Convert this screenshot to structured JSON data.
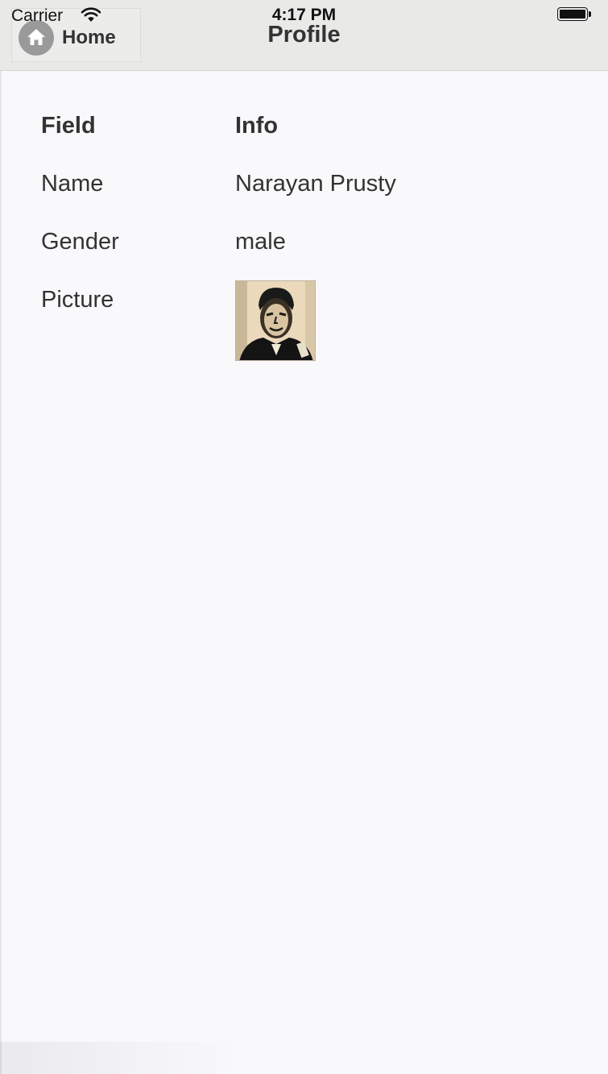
{
  "status_bar": {
    "carrier": "Carrier",
    "time": "4:17 PM",
    "wifi_icon": "wifi-icon",
    "battery_icon": "battery-icon"
  },
  "header": {
    "title": "Profile",
    "home_button_label": "Home",
    "home_icon": "home-icon",
    "background": "#e9e9e7"
  },
  "table": {
    "headers": [
      "Field",
      "Info"
    ],
    "rows": [
      {
        "field": "Name",
        "info": "Narayan Prusty"
      },
      {
        "field": "Gender",
        "info": "male"
      },
      {
        "field": "Picture",
        "info": ""
      }
    ]
  },
  "colors": {
    "text": "#333333",
    "page_background": "#f9f8fa"
  }
}
